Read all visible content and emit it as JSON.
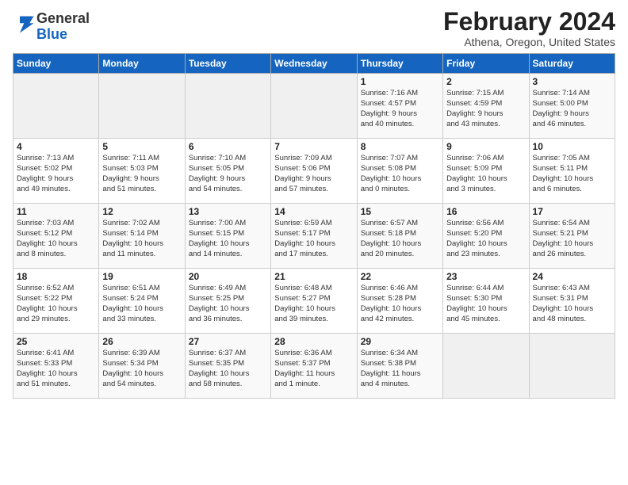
{
  "header": {
    "logo_general": "General",
    "logo_blue": "Blue",
    "month_year": "February 2024",
    "location": "Athena, Oregon, United States"
  },
  "weekdays": [
    "Sunday",
    "Monday",
    "Tuesday",
    "Wednesday",
    "Thursday",
    "Friday",
    "Saturday"
  ],
  "weeks": [
    [
      {
        "day": "",
        "detail": ""
      },
      {
        "day": "",
        "detail": ""
      },
      {
        "day": "",
        "detail": ""
      },
      {
        "day": "",
        "detail": ""
      },
      {
        "day": "1",
        "detail": "Sunrise: 7:16 AM\nSunset: 4:57 PM\nDaylight: 9 hours\nand 40 minutes."
      },
      {
        "day": "2",
        "detail": "Sunrise: 7:15 AM\nSunset: 4:59 PM\nDaylight: 9 hours\nand 43 minutes."
      },
      {
        "day": "3",
        "detail": "Sunrise: 7:14 AM\nSunset: 5:00 PM\nDaylight: 9 hours\nand 46 minutes."
      }
    ],
    [
      {
        "day": "4",
        "detail": "Sunrise: 7:13 AM\nSunset: 5:02 PM\nDaylight: 9 hours\nand 49 minutes."
      },
      {
        "day": "5",
        "detail": "Sunrise: 7:11 AM\nSunset: 5:03 PM\nDaylight: 9 hours\nand 51 minutes."
      },
      {
        "day": "6",
        "detail": "Sunrise: 7:10 AM\nSunset: 5:05 PM\nDaylight: 9 hours\nand 54 minutes."
      },
      {
        "day": "7",
        "detail": "Sunrise: 7:09 AM\nSunset: 5:06 PM\nDaylight: 9 hours\nand 57 minutes."
      },
      {
        "day": "8",
        "detail": "Sunrise: 7:07 AM\nSunset: 5:08 PM\nDaylight: 10 hours\nand 0 minutes."
      },
      {
        "day": "9",
        "detail": "Sunrise: 7:06 AM\nSunset: 5:09 PM\nDaylight: 10 hours\nand 3 minutes."
      },
      {
        "day": "10",
        "detail": "Sunrise: 7:05 AM\nSunset: 5:11 PM\nDaylight: 10 hours\nand 6 minutes."
      }
    ],
    [
      {
        "day": "11",
        "detail": "Sunrise: 7:03 AM\nSunset: 5:12 PM\nDaylight: 10 hours\nand 8 minutes."
      },
      {
        "day": "12",
        "detail": "Sunrise: 7:02 AM\nSunset: 5:14 PM\nDaylight: 10 hours\nand 11 minutes."
      },
      {
        "day": "13",
        "detail": "Sunrise: 7:00 AM\nSunset: 5:15 PM\nDaylight: 10 hours\nand 14 minutes."
      },
      {
        "day": "14",
        "detail": "Sunrise: 6:59 AM\nSunset: 5:17 PM\nDaylight: 10 hours\nand 17 minutes."
      },
      {
        "day": "15",
        "detail": "Sunrise: 6:57 AM\nSunset: 5:18 PM\nDaylight: 10 hours\nand 20 minutes."
      },
      {
        "day": "16",
        "detail": "Sunrise: 6:56 AM\nSunset: 5:20 PM\nDaylight: 10 hours\nand 23 minutes."
      },
      {
        "day": "17",
        "detail": "Sunrise: 6:54 AM\nSunset: 5:21 PM\nDaylight: 10 hours\nand 26 minutes."
      }
    ],
    [
      {
        "day": "18",
        "detail": "Sunrise: 6:52 AM\nSunset: 5:22 PM\nDaylight: 10 hours\nand 29 minutes."
      },
      {
        "day": "19",
        "detail": "Sunrise: 6:51 AM\nSunset: 5:24 PM\nDaylight: 10 hours\nand 33 minutes."
      },
      {
        "day": "20",
        "detail": "Sunrise: 6:49 AM\nSunset: 5:25 PM\nDaylight: 10 hours\nand 36 minutes."
      },
      {
        "day": "21",
        "detail": "Sunrise: 6:48 AM\nSunset: 5:27 PM\nDaylight: 10 hours\nand 39 minutes."
      },
      {
        "day": "22",
        "detail": "Sunrise: 6:46 AM\nSunset: 5:28 PM\nDaylight: 10 hours\nand 42 minutes."
      },
      {
        "day": "23",
        "detail": "Sunrise: 6:44 AM\nSunset: 5:30 PM\nDaylight: 10 hours\nand 45 minutes."
      },
      {
        "day": "24",
        "detail": "Sunrise: 6:43 AM\nSunset: 5:31 PM\nDaylight: 10 hours\nand 48 minutes."
      }
    ],
    [
      {
        "day": "25",
        "detail": "Sunrise: 6:41 AM\nSunset: 5:33 PM\nDaylight: 10 hours\nand 51 minutes."
      },
      {
        "day": "26",
        "detail": "Sunrise: 6:39 AM\nSunset: 5:34 PM\nDaylight: 10 hours\nand 54 minutes."
      },
      {
        "day": "27",
        "detail": "Sunrise: 6:37 AM\nSunset: 5:35 PM\nDaylight: 10 hours\nand 58 minutes."
      },
      {
        "day": "28",
        "detail": "Sunrise: 6:36 AM\nSunset: 5:37 PM\nDaylight: 11 hours\nand 1 minute."
      },
      {
        "day": "29",
        "detail": "Sunrise: 6:34 AM\nSunset: 5:38 PM\nDaylight: 11 hours\nand 4 minutes."
      },
      {
        "day": "",
        "detail": ""
      },
      {
        "day": "",
        "detail": ""
      }
    ]
  ]
}
